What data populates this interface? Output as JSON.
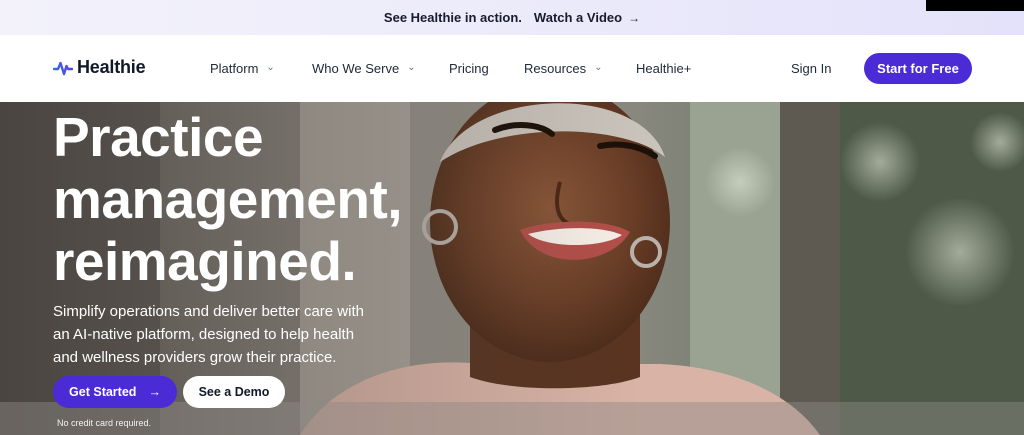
{
  "announcement": {
    "text": "See Healthie in action.",
    "link_label": "Watch a Video",
    "arrow": "→"
  },
  "nav": {
    "brand": "Healthie",
    "items": [
      {
        "label": "Platform",
        "has_dropdown": true
      },
      {
        "label": "Who We Serve",
        "has_dropdown": true
      },
      {
        "label": "Pricing",
        "has_dropdown": false
      },
      {
        "label": "Resources",
        "has_dropdown": true
      },
      {
        "label": "Healthie+",
        "has_dropdown": false
      }
    ],
    "chevron": "⌄",
    "signin": "Sign In",
    "cta": "Start for Free"
  },
  "hero": {
    "headline_lines": [
      "Practice",
      "management,",
      "reimagined."
    ],
    "subtitle": "Simplify operations and deliver better care with an AI-native platform, designed to help health and wellness providers grow their practice.",
    "primary_cta": "Get Started",
    "primary_arrow": "→",
    "secondary_cta": "See a Demo",
    "note": "No credit card required."
  },
  "colors": {
    "accent": "#4b2bd6",
    "announce_bg": "#ecebfa",
    "text_dark": "#1f2937"
  },
  "icons": {
    "logo": "pulse-wave-icon",
    "link_arrow": "arrow-right-icon",
    "dropdown": "chevron-down-icon"
  }
}
